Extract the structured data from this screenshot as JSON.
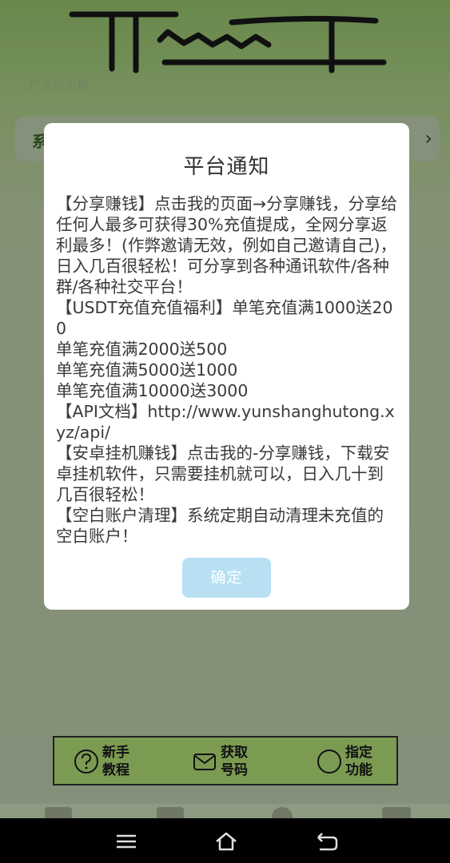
{
  "header": {
    "ad_text": "广告位出租"
  },
  "notice_bar": {
    "lead": "系"
  },
  "modal": {
    "title": "平台通知",
    "body": "【分享赚钱】点击我的页面→分享赚钱，分享给任何人最多可获得30%充值提成，全网分享返利最多！(作弊邀请无效，例如自己邀请自己)，日入几百很轻松！可分享到各种通讯软件/各种群/各种社交平台！\n【USDT充值充值福利】单笔充值满1000送200\n单笔充值满2000送500\n单笔充值满5000送1000\n单笔充值满10000送3000\n【API文档】http://www.yunshanghutong.xyz/api/\n【安卓挂机赚钱】点击我的-分享赚钱，下载安卓挂机软件，只需要挂机就可以，日入几十到几百很轻松！\n【空白账户清理】系统定期自动清理未充值的空白账户！",
    "confirm_label": "确定"
  },
  "quick_actions": [
    {
      "label": "新手\n教程",
      "icon": "question-circle-icon"
    },
    {
      "label": "获取\n号码",
      "icon": "envelope-icon"
    },
    {
      "label": "指定\n功能",
      "icon": "circle-icon"
    }
  ],
  "system_nav": {
    "items": [
      "menu-icon",
      "home-icon",
      "back-icon"
    ]
  },
  "colors": {
    "accent_button": "#b7e0f3",
    "app_green": "#7b9b52"
  }
}
